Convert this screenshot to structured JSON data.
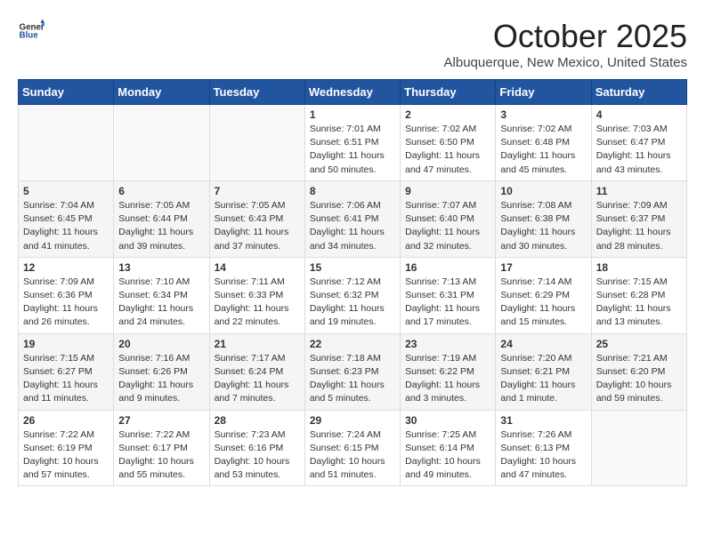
{
  "logo": {
    "general": "General",
    "blue": "Blue"
  },
  "header": {
    "month": "October 2025",
    "location": "Albuquerque, New Mexico, United States"
  },
  "weekdays": [
    "Sunday",
    "Monday",
    "Tuesday",
    "Wednesday",
    "Thursday",
    "Friday",
    "Saturday"
  ],
  "weeks": [
    [
      {
        "day": "",
        "info": ""
      },
      {
        "day": "",
        "info": ""
      },
      {
        "day": "",
        "info": ""
      },
      {
        "day": "1",
        "info": "Sunrise: 7:01 AM\nSunset: 6:51 PM\nDaylight: 11 hours\nand 50 minutes."
      },
      {
        "day": "2",
        "info": "Sunrise: 7:02 AM\nSunset: 6:50 PM\nDaylight: 11 hours\nand 47 minutes."
      },
      {
        "day": "3",
        "info": "Sunrise: 7:02 AM\nSunset: 6:48 PM\nDaylight: 11 hours\nand 45 minutes."
      },
      {
        "day": "4",
        "info": "Sunrise: 7:03 AM\nSunset: 6:47 PM\nDaylight: 11 hours\nand 43 minutes."
      }
    ],
    [
      {
        "day": "5",
        "info": "Sunrise: 7:04 AM\nSunset: 6:45 PM\nDaylight: 11 hours\nand 41 minutes."
      },
      {
        "day": "6",
        "info": "Sunrise: 7:05 AM\nSunset: 6:44 PM\nDaylight: 11 hours\nand 39 minutes."
      },
      {
        "day": "7",
        "info": "Sunrise: 7:05 AM\nSunset: 6:43 PM\nDaylight: 11 hours\nand 37 minutes."
      },
      {
        "day": "8",
        "info": "Sunrise: 7:06 AM\nSunset: 6:41 PM\nDaylight: 11 hours\nand 34 minutes."
      },
      {
        "day": "9",
        "info": "Sunrise: 7:07 AM\nSunset: 6:40 PM\nDaylight: 11 hours\nand 32 minutes."
      },
      {
        "day": "10",
        "info": "Sunrise: 7:08 AM\nSunset: 6:38 PM\nDaylight: 11 hours\nand 30 minutes."
      },
      {
        "day": "11",
        "info": "Sunrise: 7:09 AM\nSunset: 6:37 PM\nDaylight: 11 hours\nand 28 minutes."
      }
    ],
    [
      {
        "day": "12",
        "info": "Sunrise: 7:09 AM\nSunset: 6:36 PM\nDaylight: 11 hours\nand 26 minutes."
      },
      {
        "day": "13",
        "info": "Sunrise: 7:10 AM\nSunset: 6:34 PM\nDaylight: 11 hours\nand 24 minutes."
      },
      {
        "day": "14",
        "info": "Sunrise: 7:11 AM\nSunset: 6:33 PM\nDaylight: 11 hours\nand 22 minutes."
      },
      {
        "day": "15",
        "info": "Sunrise: 7:12 AM\nSunset: 6:32 PM\nDaylight: 11 hours\nand 19 minutes."
      },
      {
        "day": "16",
        "info": "Sunrise: 7:13 AM\nSunset: 6:31 PM\nDaylight: 11 hours\nand 17 minutes."
      },
      {
        "day": "17",
        "info": "Sunrise: 7:14 AM\nSunset: 6:29 PM\nDaylight: 11 hours\nand 15 minutes."
      },
      {
        "day": "18",
        "info": "Sunrise: 7:15 AM\nSunset: 6:28 PM\nDaylight: 11 hours\nand 13 minutes."
      }
    ],
    [
      {
        "day": "19",
        "info": "Sunrise: 7:15 AM\nSunset: 6:27 PM\nDaylight: 11 hours\nand 11 minutes."
      },
      {
        "day": "20",
        "info": "Sunrise: 7:16 AM\nSunset: 6:26 PM\nDaylight: 11 hours\nand 9 minutes."
      },
      {
        "day": "21",
        "info": "Sunrise: 7:17 AM\nSunset: 6:24 PM\nDaylight: 11 hours\nand 7 minutes."
      },
      {
        "day": "22",
        "info": "Sunrise: 7:18 AM\nSunset: 6:23 PM\nDaylight: 11 hours\nand 5 minutes."
      },
      {
        "day": "23",
        "info": "Sunrise: 7:19 AM\nSunset: 6:22 PM\nDaylight: 11 hours\nand 3 minutes."
      },
      {
        "day": "24",
        "info": "Sunrise: 7:20 AM\nSunset: 6:21 PM\nDaylight: 11 hours\nand 1 minute."
      },
      {
        "day": "25",
        "info": "Sunrise: 7:21 AM\nSunset: 6:20 PM\nDaylight: 10 hours\nand 59 minutes."
      }
    ],
    [
      {
        "day": "26",
        "info": "Sunrise: 7:22 AM\nSunset: 6:19 PM\nDaylight: 10 hours\nand 57 minutes."
      },
      {
        "day": "27",
        "info": "Sunrise: 7:22 AM\nSunset: 6:17 PM\nDaylight: 10 hours\nand 55 minutes."
      },
      {
        "day": "28",
        "info": "Sunrise: 7:23 AM\nSunset: 6:16 PM\nDaylight: 10 hours\nand 53 minutes."
      },
      {
        "day": "29",
        "info": "Sunrise: 7:24 AM\nSunset: 6:15 PM\nDaylight: 10 hours\nand 51 minutes."
      },
      {
        "day": "30",
        "info": "Sunrise: 7:25 AM\nSunset: 6:14 PM\nDaylight: 10 hours\nand 49 minutes."
      },
      {
        "day": "31",
        "info": "Sunrise: 7:26 AM\nSunset: 6:13 PM\nDaylight: 10 hours\nand 47 minutes."
      },
      {
        "day": "",
        "info": ""
      }
    ]
  ]
}
